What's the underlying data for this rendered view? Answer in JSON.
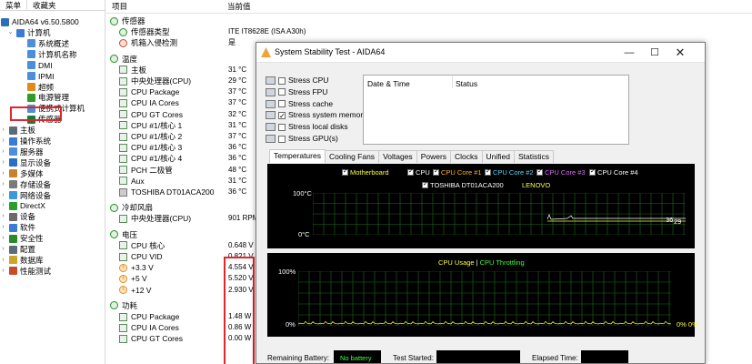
{
  "tree": {
    "tabs": [
      "菜单",
      "收藏夹"
    ],
    "root": "AIDA64 v6.50.5800",
    "items": [
      {
        "label": "计算机",
        "exp": "⌄"
      },
      {
        "label": "系统概述",
        "exp": ""
      },
      {
        "label": "计算机名称",
        "exp": ""
      },
      {
        "label": "DMI",
        "exp": ""
      },
      {
        "label": "IPMI",
        "exp": ""
      },
      {
        "label": "超频",
        "exp": ""
      },
      {
        "label": "电源管理",
        "exp": ""
      },
      {
        "label": "便携式计算机",
        "exp": ""
      },
      {
        "label": "传感器",
        "exp": ""
      },
      {
        "label": "主板",
        "exp": "›"
      },
      {
        "label": "操作系统",
        "exp": "›"
      },
      {
        "label": "服务器",
        "exp": "›"
      },
      {
        "label": "显示设备",
        "exp": "›"
      },
      {
        "label": "多媒体",
        "exp": "›"
      },
      {
        "label": "存储设备",
        "exp": "›"
      },
      {
        "label": "网络设备",
        "exp": "›"
      },
      {
        "label": "DirectX",
        "exp": "›"
      },
      {
        "label": "设备",
        "exp": "›"
      },
      {
        "label": "软件",
        "exp": "›"
      },
      {
        "label": "安全性",
        "exp": "›"
      },
      {
        "label": "配置",
        "exp": "›"
      },
      {
        "label": "数据库",
        "exp": "›"
      },
      {
        "label": "性能测试",
        "exp": "›"
      }
    ]
  },
  "list": {
    "col_item": "项目",
    "col_value": "当前值",
    "rows": [
      {
        "label": "传感器",
        "value": "",
        "cat": true
      },
      {
        "label": "传感器类型",
        "value": "ITE IT8628E (ISA A30h)"
      },
      {
        "label": "机箱入侵检测",
        "value": "是"
      },
      {
        "label": "温度",
        "value": "",
        "cat": true
      },
      {
        "label": "主板",
        "value": "31 °C"
      },
      {
        "label": "中央处理器(CPU)",
        "value": "29 °C"
      },
      {
        "label": "CPU Package",
        "value": "37 °C"
      },
      {
        "label": "CPU IA Cores",
        "value": "37 °C"
      },
      {
        "label": "CPU GT Cores",
        "value": "32 °C"
      },
      {
        "label": "CPU #1/核心 1",
        "value": "31 °C"
      },
      {
        "label": "CPU #1/核心 2",
        "value": "37 °C"
      },
      {
        "label": "CPU #1/核心 3",
        "value": "36 °C"
      },
      {
        "label": "CPU #1/核心 4",
        "value": "36 °C"
      },
      {
        "label": "PCH 二极管",
        "value": "48 °C"
      },
      {
        "label": "Aux",
        "value": "31 °C"
      },
      {
        "label": "TOSHIBA DT01ACA200",
        "value": "36 °C"
      },
      {
        "label": "冷却风扇",
        "value": "",
        "cat": true
      },
      {
        "label": "中央处理器(CPU)",
        "value": "901 RPM"
      },
      {
        "label": "电压",
        "value": "",
        "cat": true
      },
      {
        "label": "CPU 核心",
        "value": "0.648 V"
      },
      {
        "label": "CPU VID",
        "value": "0.821 V"
      },
      {
        "label": "+3.3 V",
        "value": "4.554 V"
      },
      {
        "label": "+5 V",
        "value": "5.520 V"
      },
      {
        "label": "+12 V",
        "value": "2.930 V"
      },
      {
        "label": "功耗",
        "value": "",
        "cat": true
      },
      {
        "label": "CPU Package",
        "value": "1.48 W"
      },
      {
        "label": "CPU IA Cores",
        "value": "0.86 W"
      },
      {
        "label": "CPU GT Cores",
        "value": "0.00 W"
      }
    ]
  },
  "dialog": {
    "title": "System Stability Test - AIDA64",
    "stress": [
      {
        "label": "Stress CPU",
        "checked": false
      },
      {
        "label": "Stress FPU",
        "checked": false
      },
      {
        "label": "Stress cache",
        "checked": false
      },
      {
        "label": "Stress system memory",
        "checked": true
      },
      {
        "label": "Stress local disks",
        "checked": false
      },
      {
        "label": "Stress GPU(s)",
        "checked": false
      }
    ],
    "log_col_date": "Date & Time",
    "log_col_status": "Status",
    "tabs": [
      "Temperatures",
      "Cooling Fans",
      "Voltages",
      "Powers",
      "Clocks",
      "Unified",
      "Statistics"
    ],
    "temp_legend": [
      {
        "label": "Motherboard",
        "color": "#ffff3c"
      },
      {
        "label": "CPU",
        "color": "#ffffff"
      },
      {
        "label": "CPU Core #1",
        "color": "#ffb020"
      },
      {
        "label": "CPU Core #2",
        "color": "#5ad7ff"
      },
      {
        "label": "CPU Core #3",
        "color": "#e070ff"
      },
      {
        "label": "CPU Core #4",
        "color": "#ffffff"
      },
      {
        "label": "TOSHIBA DT01ACA200",
        "color": "#ffffff"
      },
      {
        "label": "LENOVO",
        "color": "#ffff3c"
      }
    ],
    "temp_ymax": "100°C",
    "temp_ymin": "0°C",
    "temp_right_a": "36",
    "temp_right_b": "29",
    "cpu_legend_usage": "CPU Usage",
    "cpu_legend_sep": "|",
    "cpu_legend_throttling": "CPU Throttling",
    "cpu_ymax": "100%",
    "cpu_ymin": "0%",
    "cpu_right": "0% 0%",
    "remaining_battery_label": "Remaining Battery:",
    "remaining_battery_value": "No battery",
    "test_started_label": "Test Started:",
    "elapsed_time_label": "Elapsed Time:"
  }
}
